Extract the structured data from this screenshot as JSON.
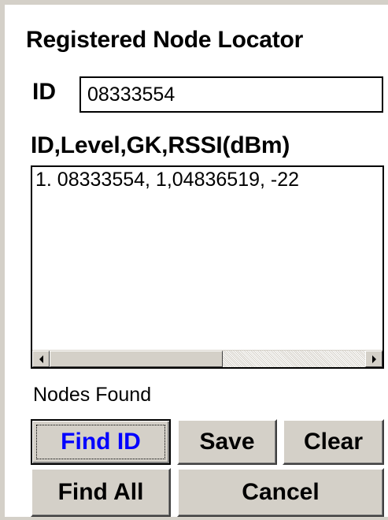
{
  "title": "Registered Node Locator",
  "id_field": {
    "label": "ID",
    "value": "08333554"
  },
  "results": {
    "header": "ID,Level,GK,RSSI(dBm)",
    "items": [
      "1. 08333554, 1,04836519, -22"
    ]
  },
  "status": "Nodes Found",
  "buttons": {
    "find_id": "Find ID",
    "save": "Save",
    "clear": "Clear",
    "find_all": "Find All",
    "cancel": "Cancel"
  },
  "colors": {
    "focused_button_text": "#0000ff",
    "button_face": "#d4d0c8"
  }
}
